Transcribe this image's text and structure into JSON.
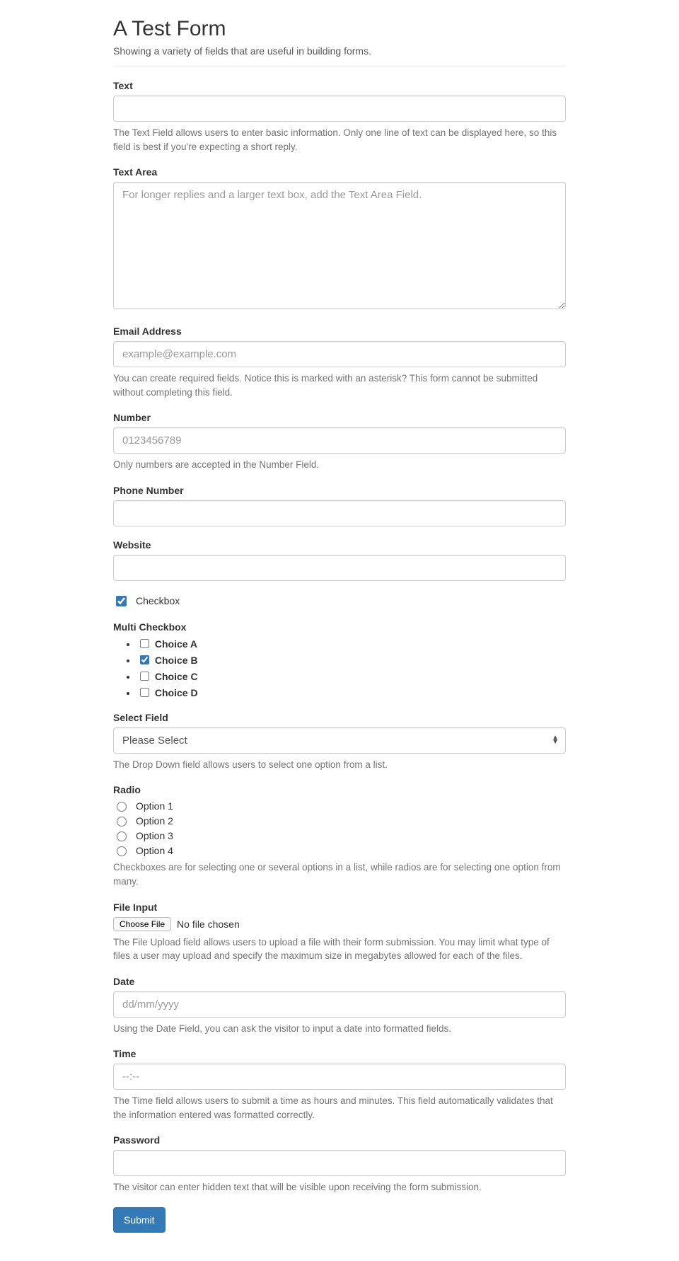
{
  "header": {
    "title": "A Test Form",
    "subtitle": "Showing a variety of fields that are useful in building forms."
  },
  "fields": {
    "text": {
      "label": "Text",
      "help": "The Text Field allows users to enter basic information. Only one line of text can be displayed here, so this field is best if you're expecting a short reply."
    },
    "textarea": {
      "label": "Text Area",
      "placeholder": "For longer replies and a larger text box, add the Text Area Field."
    },
    "email": {
      "label": "Email Address",
      "placeholder": "example@example.com",
      "help": "You can create required fields. Notice this is marked with an asterisk? This form cannot be submitted without completing this field."
    },
    "number": {
      "label": "Number",
      "placeholder": "0123456789",
      "help": "Only numbers are accepted in the Number Field."
    },
    "phone": {
      "label": "Phone Number"
    },
    "website": {
      "label": "Website"
    },
    "checkbox": {
      "label": "Checkbox",
      "checked": true
    },
    "multicheck": {
      "label": "Multi Checkbox",
      "choices": [
        {
          "label": "Choice A",
          "checked": false
        },
        {
          "label": "Choice B",
          "checked": true
        },
        {
          "label": "Choice C",
          "checked": false
        },
        {
          "label": "Choice D",
          "checked": false
        }
      ]
    },
    "select": {
      "label": "Select Field",
      "selected": "Please Select",
      "help": "The Drop Down field allows users to select one option from a list."
    },
    "radio": {
      "label": "Radio",
      "options": [
        {
          "label": "Option 1"
        },
        {
          "label": "Option 2"
        },
        {
          "label": "Option 3"
        },
        {
          "label": "Option 4"
        }
      ],
      "help": "Checkboxes are for selecting one or several options in a list, while radios are for selecting one option from many."
    },
    "file": {
      "label": "File Input",
      "button": "Choose File",
      "status": "No file chosen",
      "help": "The File Upload field allows users to upload a file with their form submission. You may limit what type of files a user may upload and specify the maximum size in megabytes allowed for each of the files."
    },
    "date": {
      "label": "Date",
      "placeholder": "dd/mm/yyyy",
      "help": "Using the Date Field, you can ask the visitor to input a date into formatted fields."
    },
    "time": {
      "label": "Time",
      "placeholder": "--:--",
      "help": "The Time field allows users to submit a time as hours and minutes. This field automatically validates that the information entered was formatted correctly."
    },
    "password": {
      "label": "Password",
      "help": "The visitor can enter hidden text that will be visible upon receiving the form submission."
    }
  },
  "submit": {
    "label": "Submit"
  }
}
